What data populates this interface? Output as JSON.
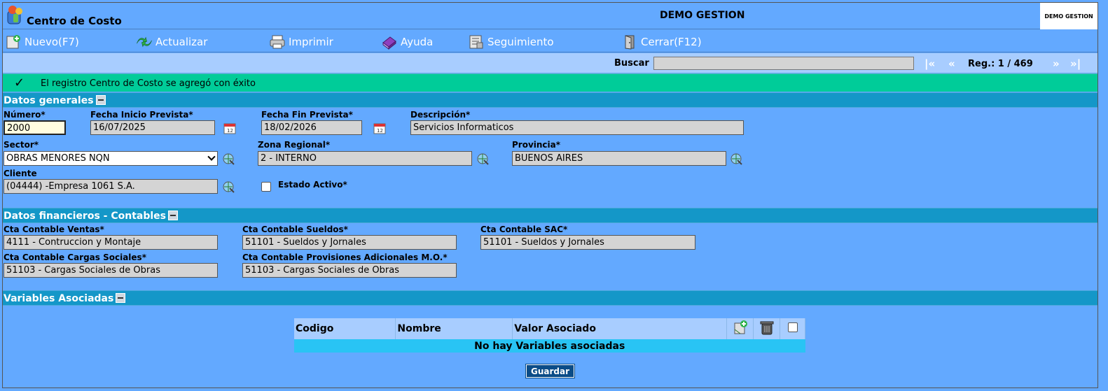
{
  "header": {
    "app_title": "Centro de Costo",
    "company_title": "DEMO GESTION",
    "brand_label": "DEMO GESTION"
  },
  "toolbar": {
    "nuevo": "Nuevo(F7)",
    "actualizar": "Actualizar",
    "imprimir": "Imprimir",
    "ayuda": "Ayuda",
    "seguimiento": "Seguimiento",
    "cerrar": "Cerrar(F12)"
  },
  "search": {
    "label": "Buscar",
    "value": "",
    "first": "|«",
    "prev": "«",
    "record_label": "Reg.: 1 / 469",
    "next": "»",
    "last": "»|"
  },
  "notice": {
    "check_glyph": "✓",
    "message": "El registro Centro de Costo se agregó con éxito"
  },
  "general": {
    "title": "Datos generales",
    "numero_label": "Número*",
    "numero_value": "2000",
    "fecha_inicio_label": "Fecha Inicio Prevista*",
    "fecha_inicio_value": "16/07/2025",
    "fecha_fin_label": "Fecha Fin Prevista*",
    "fecha_fin_value": "18/02/2026",
    "descripcion_label": "Descripción*",
    "descripcion_value": "Servicios Informaticos",
    "sector_label": "Sector*",
    "sector_value": "OBRAS MENORES NQN",
    "zona_label": "Zona Regional*",
    "zona_value": "2 - INTERNO",
    "provincia_label": "Provincia*",
    "provincia_value": "BUENOS AIRES",
    "cliente_label": "Cliente",
    "cliente_value": "(04444) -Empresa 1061 S.A.",
    "estado_label": "Estado Activo*"
  },
  "financial": {
    "title": "Datos financieros - Contables",
    "ventas_label": "Cta Contable Ventas*",
    "ventas_value": "4111 - Contruccion y Montaje",
    "sueldos_label": "Cta Contable Sueldos*",
    "sueldos_value": "51101 - Sueldos y Jornales",
    "sac_label": "Cta Contable SAC*",
    "sac_value": "51101 - Sueldos y Jornales",
    "cargas_label": "Cta Contable Cargas Sociales*",
    "cargas_value": "51103 - Cargas Sociales de Obras",
    "provisiones_label": "Cta Contable Provisiones Adicionales M.O.*",
    "provisiones_value": "51103 - Cargas Sociales de Obras"
  },
  "variables": {
    "title": "Variables Asociadas",
    "col_codigo": "Codigo",
    "col_nombre": "Nombre",
    "col_valor": "Valor Asociado",
    "empty_message": "No hay Variables asociadas"
  },
  "actions": {
    "save_label": "Guardar"
  },
  "colors": {
    "background": "#63a9ff",
    "section": "#1497c8",
    "success": "#00cc99",
    "save_button": "#0b4c87"
  }
}
